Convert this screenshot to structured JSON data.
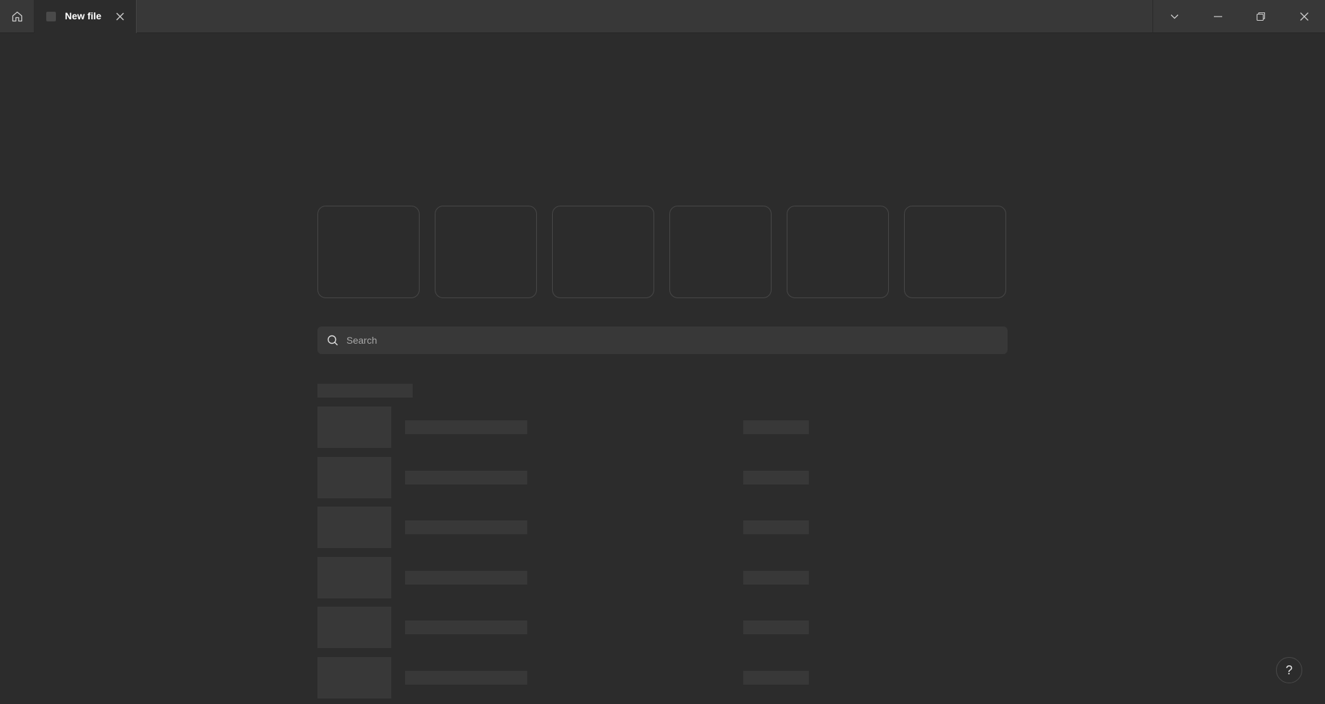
{
  "titlebar": {
    "home_icon": "home-icon",
    "tab": {
      "label": "New file",
      "close_icon": "close-icon"
    },
    "window_controls": {
      "dropdown_icon": "chevron-down-icon",
      "minimize_icon": "minimize-icon",
      "restore_icon": "restore-icon",
      "close_icon": "close-icon"
    }
  },
  "main": {
    "template_cards": [
      {},
      {},
      {},
      {},
      {},
      {}
    ],
    "search": {
      "placeholder": "Search",
      "value": ""
    },
    "recent_list": [
      {},
      {},
      {},
      {},
      {},
      {}
    ]
  },
  "help": {
    "label": "?"
  },
  "colors": {
    "background": "#2c2c2c",
    "titlebar": "#383838",
    "skeleton": "#383838",
    "card_border": "#484848"
  }
}
